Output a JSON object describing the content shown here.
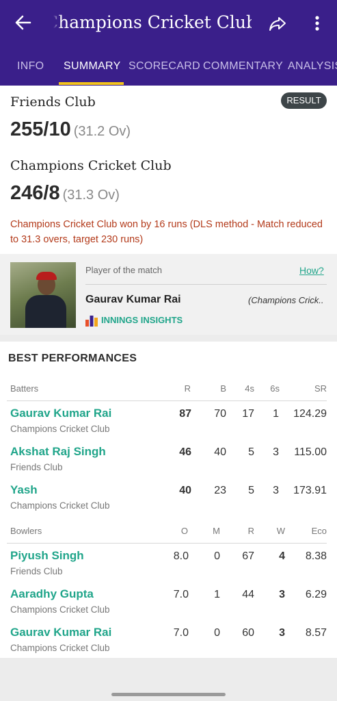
{
  "app_bar": {
    "title": "Champions Cricket Club",
    "tabs": [
      {
        "label": "INFO"
      },
      {
        "label": "SUMMARY"
      },
      {
        "label": "SCORECARD"
      },
      {
        "label": "COMMENTARY"
      },
      {
        "label": "ANALYSIS"
      }
    ],
    "active_tab": "SUMMARY",
    "accent_color": "#f2c31b",
    "bar_color": "#3a1f8a"
  },
  "match": {
    "badge": "RESULT",
    "innings": [
      {
        "team": "Friends Club",
        "score": "255/10",
        "overs": "(31.2 Ov)"
      },
      {
        "team": "Champions Cricket Club",
        "score": "246/8",
        "overs": "(31.3 Ov)"
      }
    ],
    "result": "Champions Cricket Club won by 16 runs (DLS method - Match reduced to 31.3 overs, target 230 runs)"
  },
  "player_of_match": {
    "label": "Player of the match",
    "how_link": "How?",
    "name": "Gaurav Kumar Rai",
    "team": "(Champions Crick..",
    "insights_label": "INNINGS INSIGHTS"
  },
  "best_performances": {
    "title": "BEST PERFORMANCES",
    "batters_header": {
      "name": "Batters",
      "cols": [
        "R",
        "B",
        "4s",
        "6s",
        "SR"
      ]
    },
    "batters": [
      {
        "name": "Gaurav Kumar Rai",
        "team": "Champions Cricket Club",
        "stats": [
          "87",
          "70",
          "17",
          "1",
          "124.29"
        ]
      },
      {
        "name": "Akshat Raj Singh",
        "team": "Friends Club",
        "stats": [
          "46",
          "40",
          "5",
          "3",
          "115.00"
        ]
      },
      {
        "name": "Yash",
        "team": "Champions Cricket Club",
        "stats": [
          "40",
          "23",
          "5",
          "3",
          "173.91"
        ]
      }
    ],
    "bowlers_header": {
      "name": "Bowlers",
      "cols": [
        "O",
        "M",
        "R",
        "W",
        "Eco"
      ]
    },
    "bowlers": [
      {
        "name": "Piyush Singh",
        "team": "Friends Club",
        "stats": [
          "8.0",
          "0",
          "67",
          "4",
          "8.38"
        ]
      },
      {
        "name": "Aaradhy Gupta",
        "team": "Champions Cricket Club",
        "stats": [
          "7.0",
          "1",
          "44",
          "3",
          "6.29"
        ]
      },
      {
        "name": "Gaurav Kumar Rai",
        "team": "Champions Cricket Club",
        "stats": [
          "7.0",
          "0",
          "60",
          "3",
          "8.57"
        ]
      }
    ]
  }
}
